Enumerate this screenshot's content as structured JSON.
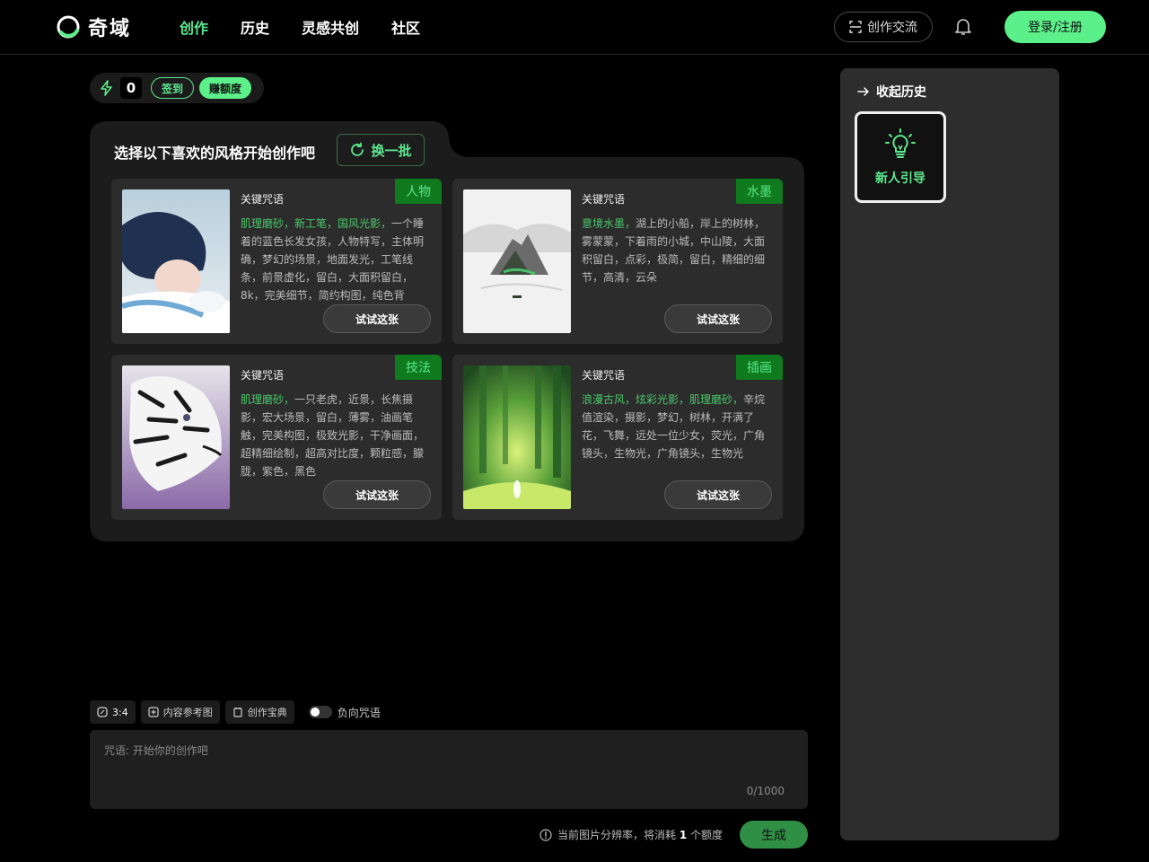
{
  "brand": {
    "name": "奇域"
  },
  "nav": {
    "items": [
      "创作",
      "历史",
      "灵感共创",
      "社区"
    ],
    "active": "创作"
  },
  "header": {
    "exchange_label": "创作交流",
    "login_label": "登录/注册"
  },
  "credits": {
    "count": "0",
    "signin_label": "签到",
    "earn_label": "赚额度"
  },
  "styles_panel": {
    "title": "选择以下喜欢的风格开始创作吧",
    "refresh_label": "换一批",
    "cards": [
      {
        "tag": "人物",
        "label": "关键咒语",
        "keywords": "肌理磨砂，新工笔，国风光影，",
        "desc": "一个睡着的蓝色长发女孩，人物特写，主体明确，梦幻的场景，地面发光，工笔线条，前景虚化，留白，大面积留白，8k，完美细节，简约构图，纯色背",
        "button": "试试这张"
      },
      {
        "tag": "水墨",
        "label": "关键咒语",
        "keywords": "意境水墨，",
        "desc": "湖上的小船，岸上的树林，雾蒙蒙，下着雨的小城，中山陵，大面积留白，点彩，极简，留白，精细的细节，高清，云朵",
        "button": "试试这张"
      },
      {
        "tag": "技法",
        "label": "关键咒语",
        "keywords": "肌理磨砂，",
        "desc": "一只老虎，近景，长焦摄影，宏大场景，留白，薄雾，油画笔触，完美构图，极致光影，干净画面，超精细绘制，超高对比度，颗粒感，朦胧，紫色，黑色",
        "button": "试试这张"
      },
      {
        "tag": "插画",
        "label": "关键咒语",
        "keywords": "浪漫古风，炫彩光影，肌理磨砂，",
        "desc": "辛烷值渲染，摄影，梦幻，树林，开满了花，飞舞，远处一位少女，荧光，广角镜头，生物光，广角镜头，生物光",
        "button": "试试这张"
      }
    ]
  },
  "toolbar": {
    "ratio": "3:4",
    "ref_image": "内容参考图",
    "guide_book": "创作宝典",
    "negative": "负向咒语"
  },
  "prompt": {
    "placeholder": "咒语: 开始你的创作吧",
    "count": "0/1000"
  },
  "footer": {
    "cost_prefix": "当前图片分辨率，将消耗",
    "cost_value": "1",
    "cost_suffix": "个额度",
    "generate_label": "生成"
  },
  "history_panel": {
    "title": "收起历史",
    "guide_label": "新人引导"
  },
  "colors": {
    "accent": "#5cf08a",
    "tag_bg": "#0f7a1e",
    "highlight": "#4ac96a"
  }
}
